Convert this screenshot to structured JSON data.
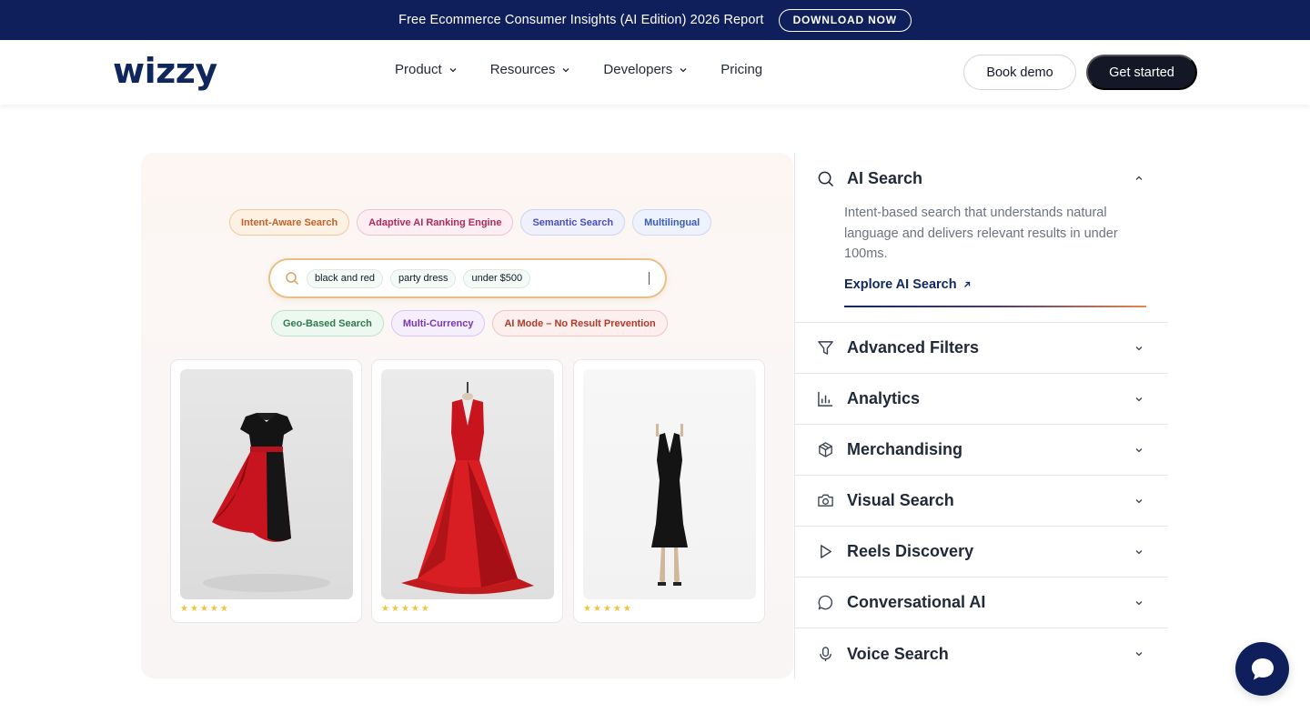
{
  "banner": {
    "text": "Free Ecommerce Consumer Insights (AI Edition) 2026 Report",
    "button": "DOWNLOAD NOW"
  },
  "nav": {
    "logo": "wizzy",
    "menu": [
      {
        "label": "Product",
        "icon": "chevron-down-icon"
      },
      {
        "label": "Resources",
        "icon": "chevron-down-icon"
      },
      {
        "label": "Developers",
        "icon": "chevron-down-icon"
      },
      {
        "label": "Pricing"
      }
    ],
    "book_demo": "Book demo",
    "get_started": "Get started"
  },
  "showcase": {
    "top_chips": [
      "Intent-Aware Search",
      "Adaptive AI Ranking Engine",
      "Semantic Search",
      "Multilingual"
    ],
    "search_tags": [
      "black and red",
      "party dress",
      "under $500"
    ],
    "bottom_chips": [
      "Geo-Based Search",
      "Multi-Currency",
      "AI Mode – No Result Prevention"
    ],
    "products": [
      {
        "name": "black and red a-line dress",
        "rating": 5
      },
      {
        "name": "red satin gown",
        "rating": 5
      },
      {
        "name": "black midi dress",
        "rating": 5
      }
    ]
  },
  "accordion": {
    "open": {
      "title": "AI Search",
      "icon": "search-icon",
      "description": "Intent-based search that understands natural language and delivers relevant results in under 100ms.",
      "link": "Explore AI Search"
    },
    "items": [
      {
        "title": "Advanced Filters",
        "icon": "filter-icon"
      },
      {
        "title": "Analytics",
        "icon": "bar-chart-icon"
      },
      {
        "title": "Merchandising",
        "icon": "box-icon"
      },
      {
        "title": "Visual Search",
        "icon": "camera-icon"
      },
      {
        "title": "Reels Discovery",
        "icon": "play-icon"
      },
      {
        "title": "Conversational AI",
        "icon": "chat-bubble-icon"
      },
      {
        "title": "Voice Search",
        "icon": "microphone-icon"
      }
    ]
  },
  "colors": {
    "brand_navy": "#0f1f5c",
    "dark_button": "#141826",
    "star": "#f2c23b",
    "search_border": "#e9bf87"
  }
}
